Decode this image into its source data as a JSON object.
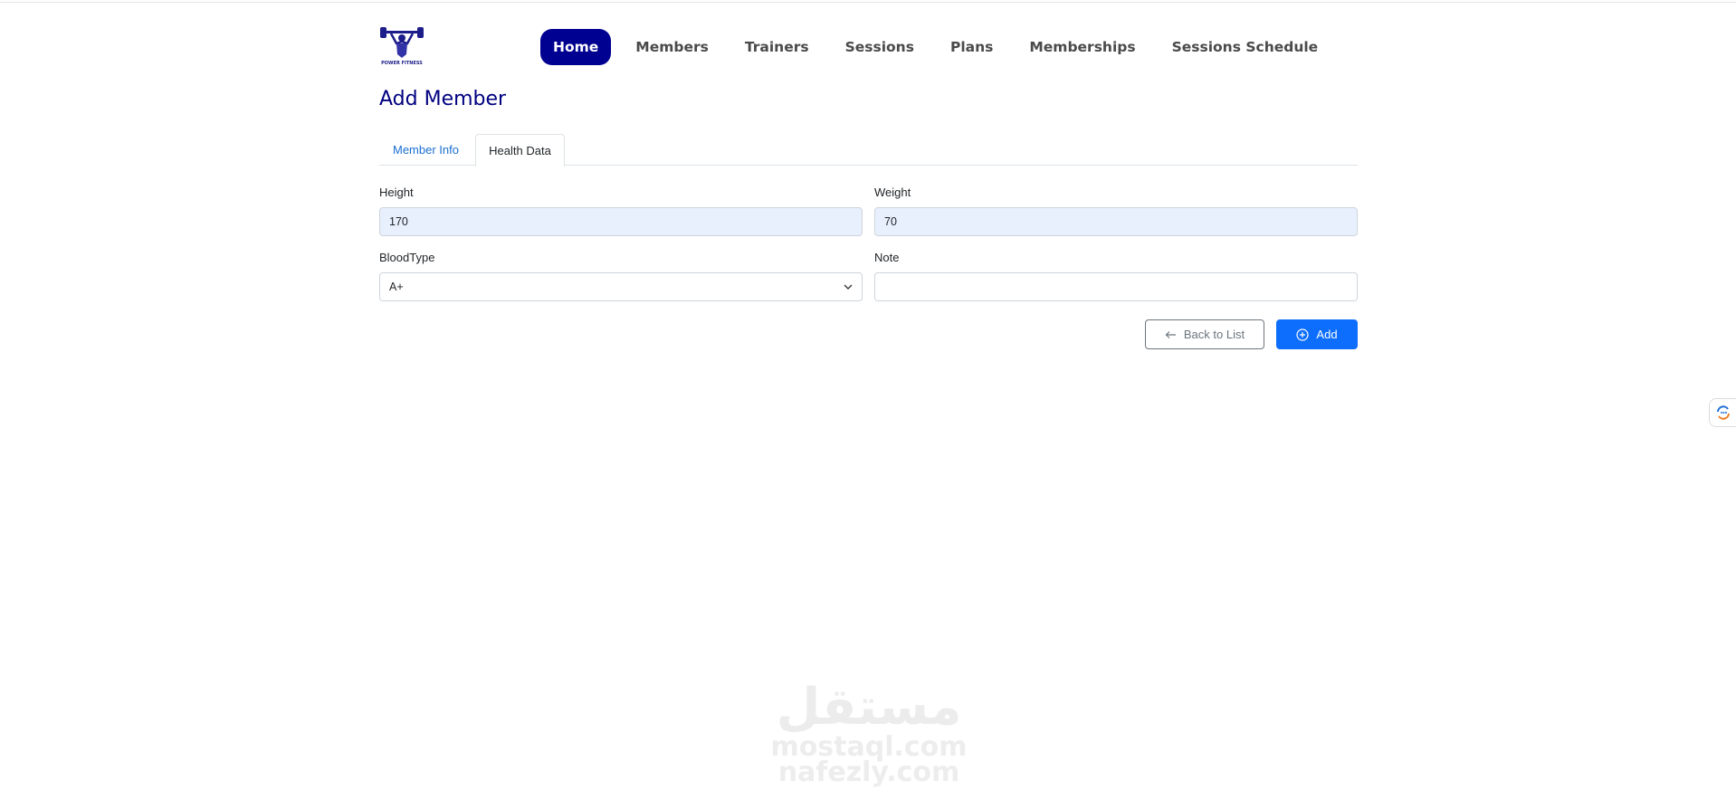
{
  "brand": {
    "logo_name": "power-fitness-logo",
    "logo_text": "POWER FITNESS"
  },
  "nav": {
    "items": [
      {
        "label": "Home",
        "active": true
      },
      {
        "label": "Members"
      },
      {
        "label": "Trainers"
      },
      {
        "label": "Sessions"
      },
      {
        "label": "Plans"
      },
      {
        "label": "Memberships"
      },
      {
        "label": "Sessions Schedule"
      }
    ]
  },
  "page": {
    "title": "Add Member"
  },
  "tabs": [
    {
      "label": "Member Info",
      "active": false
    },
    {
      "label": "Health Data",
      "active": true
    }
  ],
  "form": {
    "height": {
      "label": "Height",
      "value": "170"
    },
    "weight": {
      "label": "Weight",
      "value": "70"
    },
    "blood_type": {
      "label": "BloodType",
      "value": "A+"
    },
    "note": {
      "label": "Note",
      "value": ""
    }
  },
  "actions": {
    "back_label": "Back to List",
    "add_label": "Add"
  },
  "watermark": {
    "arabic": "مستقل",
    "line1": "mostaql.com",
    "line2": "nafezly.com"
  },
  "colors": {
    "nav_active_bg": "#000091",
    "title": "#000080",
    "primary": "#0d6efd",
    "filled_field_bg": "#e8f0fe"
  }
}
